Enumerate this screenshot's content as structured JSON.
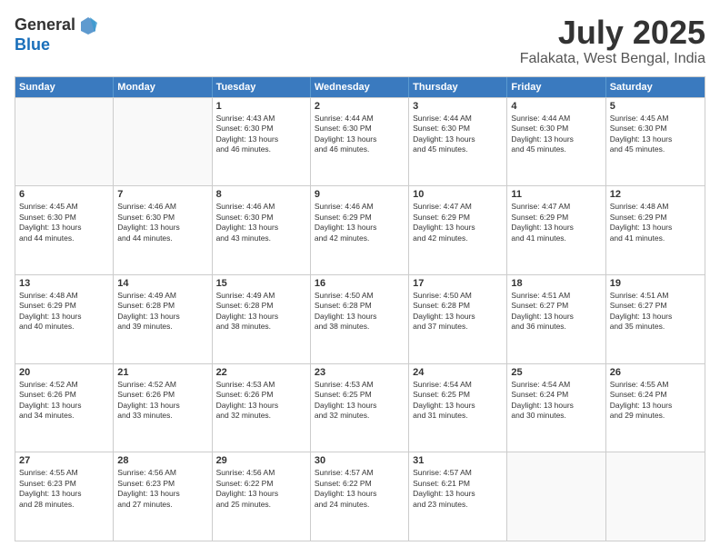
{
  "header": {
    "logo_general": "General",
    "logo_blue": "Blue",
    "month_title": "July 2025",
    "location": "Falakata, West Bengal, India"
  },
  "weekdays": [
    "Sunday",
    "Monday",
    "Tuesday",
    "Wednesday",
    "Thursday",
    "Friday",
    "Saturday"
  ],
  "rows": [
    [
      {
        "day": "",
        "lines": [],
        "empty": true
      },
      {
        "day": "",
        "lines": [],
        "empty": true
      },
      {
        "day": "1",
        "lines": [
          "Sunrise: 4:43 AM",
          "Sunset: 6:30 PM",
          "Daylight: 13 hours",
          "and 46 minutes."
        ]
      },
      {
        "day": "2",
        "lines": [
          "Sunrise: 4:44 AM",
          "Sunset: 6:30 PM",
          "Daylight: 13 hours",
          "and 46 minutes."
        ]
      },
      {
        "day": "3",
        "lines": [
          "Sunrise: 4:44 AM",
          "Sunset: 6:30 PM",
          "Daylight: 13 hours",
          "and 45 minutes."
        ]
      },
      {
        "day": "4",
        "lines": [
          "Sunrise: 4:44 AM",
          "Sunset: 6:30 PM",
          "Daylight: 13 hours",
          "and 45 minutes."
        ]
      },
      {
        "day": "5",
        "lines": [
          "Sunrise: 4:45 AM",
          "Sunset: 6:30 PM",
          "Daylight: 13 hours",
          "and 45 minutes."
        ]
      }
    ],
    [
      {
        "day": "6",
        "lines": [
          "Sunrise: 4:45 AM",
          "Sunset: 6:30 PM",
          "Daylight: 13 hours",
          "and 44 minutes."
        ]
      },
      {
        "day": "7",
        "lines": [
          "Sunrise: 4:46 AM",
          "Sunset: 6:30 PM",
          "Daylight: 13 hours",
          "and 44 minutes."
        ]
      },
      {
        "day": "8",
        "lines": [
          "Sunrise: 4:46 AM",
          "Sunset: 6:30 PM",
          "Daylight: 13 hours",
          "and 43 minutes."
        ]
      },
      {
        "day": "9",
        "lines": [
          "Sunrise: 4:46 AM",
          "Sunset: 6:29 PM",
          "Daylight: 13 hours",
          "and 42 minutes."
        ]
      },
      {
        "day": "10",
        "lines": [
          "Sunrise: 4:47 AM",
          "Sunset: 6:29 PM",
          "Daylight: 13 hours",
          "and 42 minutes."
        ]
      },
      {
        "day": "11",
        "lines": [
          "Sunrise: 4:47 AM",
          "Sunset: 6:29 PM",
          "Daylight: 13 hours",
          "and 41 minutes."
        ]
      },
      {
        "day": "12",
        "lines": [
          "Sunrise: 4:48 AM",
          "Sunset: 6:29 PM",
          "Daylight: 13 hours",
          "and 41 minutes."
        ]
      }
    ],
    [
      {
        "day": "13",
        "lines": [
          "Sunrise: 4:48 AM",
          "Sunset: 6:29 PM",
          "Daylight: 13 hours",
          "and 40 minutes."
        ]
      },
      {
        "day": "14",
        "lines": [
          "Sunrise: 4:49 AM",
          "Sunset: 6:28 PM",
          "Daylight: 13 hours",
          "and 39 minutes."
        ]
      },
      {
        "day": "15",
        "lines": [
          "Sunrise: 4:49 AM",
          "Sunset: 6:28 PM",
          "Daylight: 13 hours",
          "and 38 minutes."
        ]
      },
      {
        "day": "16",
        "lines": [
          "Sunrise: 4:50 AM",
          "Sunset: 6:28 PM",
          "Daylight: 13 hours",
          "and 38 minutes."
        ]
      },
      {
        "day": "17",
        "lines": [
          "Sunrise: 4:50 AM",
          "Sunset: 6:28 PM",
          "Daylight: 13 hours",
          "and 37 minutes."
        ]
      },
      {
        "day": "18",
        "lines": [
          "Sunrise: 4:51 AM",
          "Sunset: 6:27 PM",
          "Daylight: 13 hours",
          "and 36 minutes."
        ]
      },
      {
        "day": "19",
        "lines": [
          "Sunrise: 4:51 AM",
          "Sunset: 6:27 PM",
          "Daylight: 13 hours",
          "and 35 minutes."
        ]
      }
    ],
    [
      {
        "day": "20",
        "lines": [
          "Sunrise: 4:52 AM",
          "Sunset: 6:26 PM",
          "Daylight: 13 hours",
          "and 34 minutes."
        ]
      },
      {
        "day": "21",
        "lines": [
          "Sunrise: 4:52 AM",
          "Sunset: 6:26 PM",
          "Daylight: 13 hours",
          "and 33 minutes."
        ]
      },
      {
        "day": "22",
        "lines": [
          "Sunrise: 4:53 AM",
          "Sunset: 6:26 PM",
          "Daylight: 13 hours",
          "and 32 minutes."
        ]
      },
      {
        "day": "23",
        "lines": [
          "Sunrise: 4:53 AM",
          "Sunset: 6:25 PM",
          "Daylight: 13 hours",
          "and 32 minutes."
        ]
      },
      {
        "day": "24",
        "lines": [
          "Sunrise: 4:54 AM",
          "Sunset: 6:25 PM",
          "Daylight: 13 hours",
          "and 31 minutes."
        ]
      },
      {
        "day": "25",
        "lines": [
          "Sunrise: 4:54 AM",
          "Sunset: 6:24 PM",
          "Daylight: 13 hours",
          "and 30 minutes."
        ]
      },
      {
        "day": "26",
        "lines": [
          "Sunrise: 4:55 AM",
          "Sunset: 6:24 PM",
          "Daylight: 13 hours",
          "and 29 minutes."
        ]
      }
    ],
    [
      {
        "day": "27",
        "lines": [
          "Sunrise: 4:55 AM",
          "Sunset: 6:23 PM",
          "Daylight: 13 hours",
          "and 28 minutes."
        ]
      },
      {
        "day": "28",
        "lines": [
          "Sunrise: 4:56 AM",
          "Sunset: 6:23 PM",
          "Daylight: 13 hours",
          "and 27 minutes."
        ]
      },
      {
        "day": "29",
        "lines": [
          "Sunrise: 4:56 AM",
          "Sunset: 6:22 PM",
          "Daylight: 13 hours",
          "and 25 minutes."
        ]
      },
      {
        "day": "30",
        "lines": [
          "Sunrise: 4:57 AM",
          "Sunset: 6:22 PM",
          "Daylight: 13 hours",
          "and 24 minutes."
        ]
      },
      {
        "day": "31",
        "lines": [
          "Sunrise: 4:57 AM",
          "Sunset: 6:21 PM",
          "Daylight: 13 hours",
          "and 23 minutes."
        ]
      },
      {
        "day": "",
        "lines": [],
        "empty": true
      },
      {
        "day": "",
        "lines": [],
        "empty": true
      }
    ]
  ]
}
